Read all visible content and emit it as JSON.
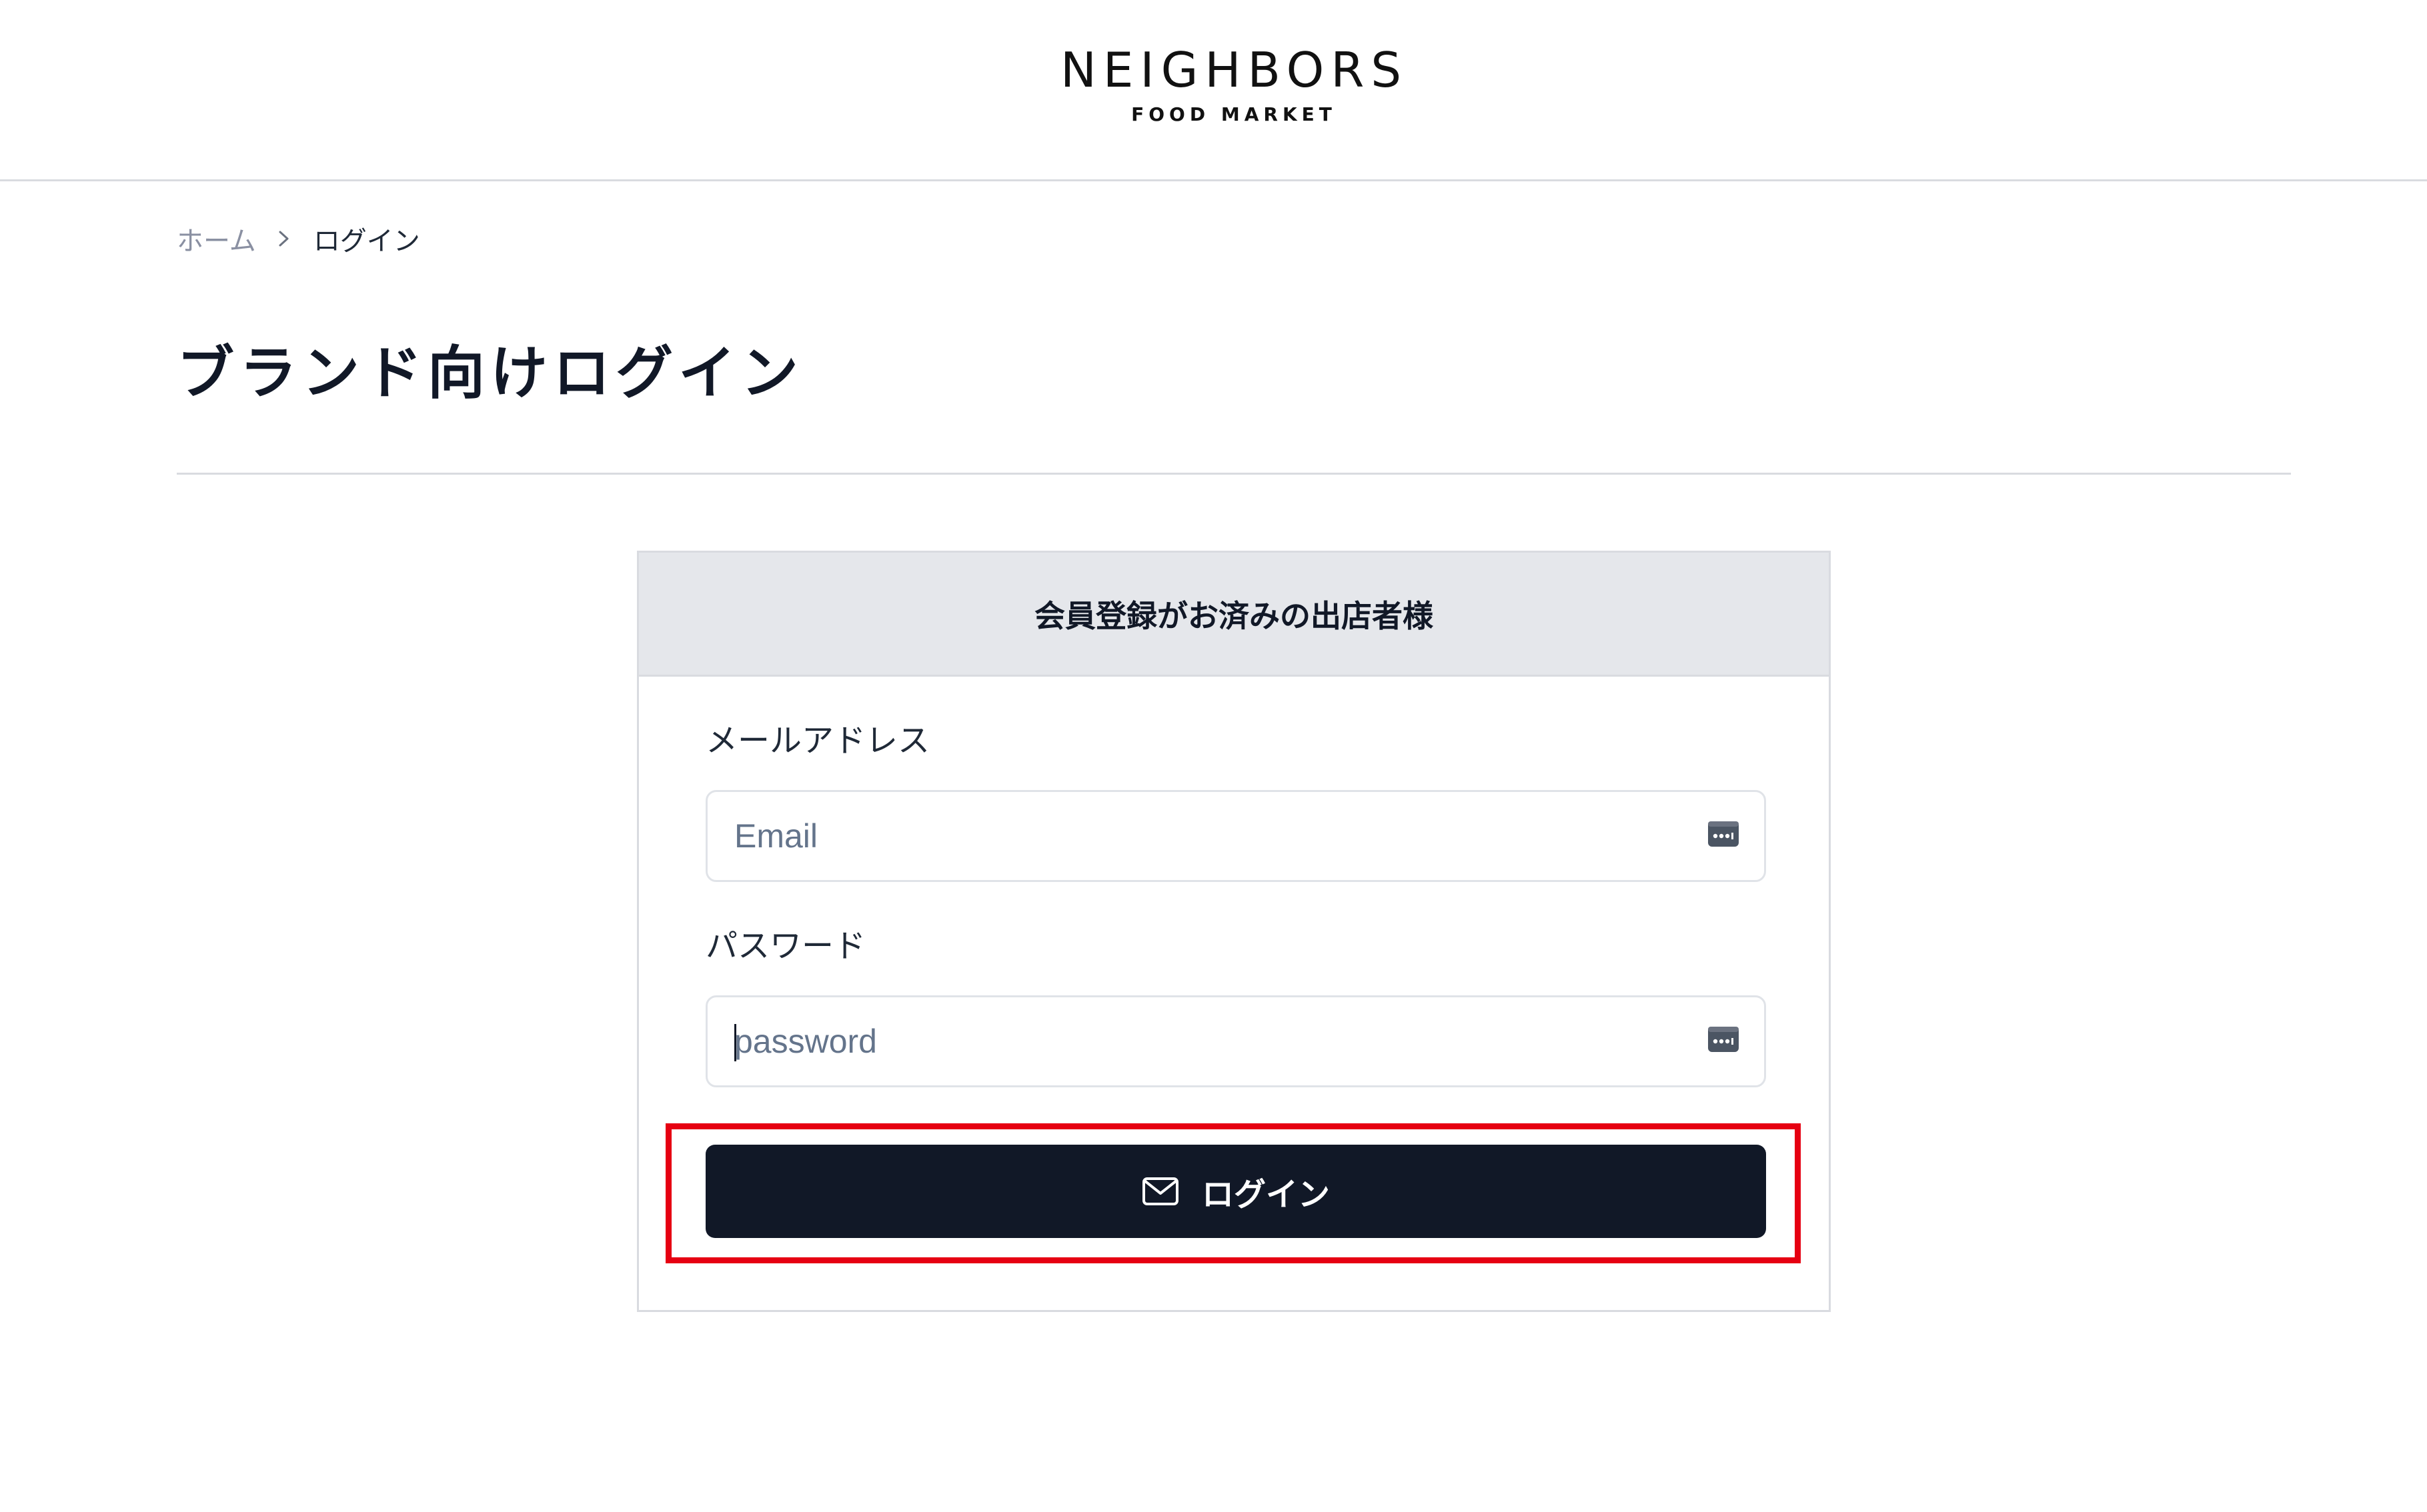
{
  "header": {
    "logo_main": "NEIGHBORS",
    "logo_sub": "FOOD MARKET"
  },
  "breadcrumb": {
    "home": "ホーム",
    "separator_icon": "chevron-right-icon",
    "current": "ログイン"
  },
  "page": {
    "title": "ブランド向けログイン"
  },
  "login_card": {
    "header": "会員登録がお済みの出店者様",
    "email": {
      "label": "メールアドレス",
      "placeholder": "Email",
      "value": "",
      "icon": "password-manager-icon"
    },
    "password": {
      "label": "パスワード",
      "placeholder": "password",
      "value": "",
      "icon": "password-manager-icon"
    },
    "login_button": {
      "label": "ログイン",
      "icon": "mail-icon"
    }
  },
  "colors": {
    "button_bg": "#111827",
    "highlight": "#e60012",
    "card_header_bg": "#e5e7eb",
    "divider": "#d9dbe0",
    "breadcrumb_home": "#8a90a2"
  }
}
